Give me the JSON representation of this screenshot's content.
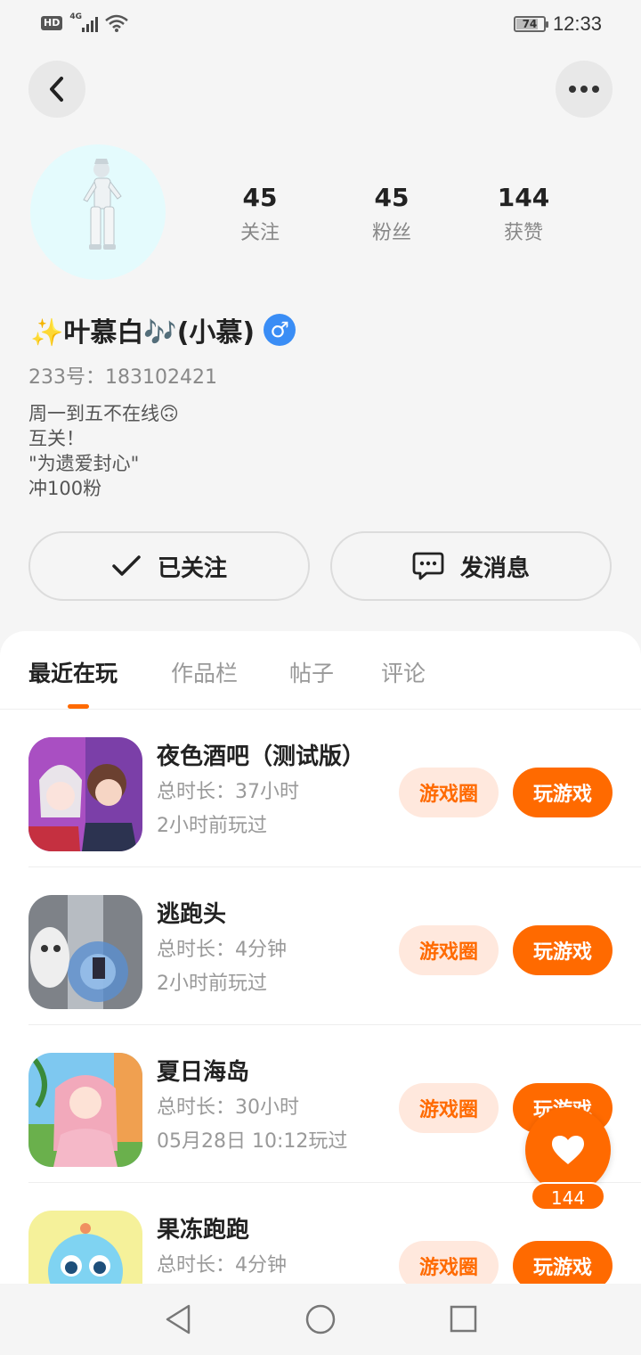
{
  "status_bar": {
    "hd": "HD",
    "network": "4G",
    "battery": "74",
    "battery_level": 0.74,
    "time": "12:33"
  },
  "profile": {
    "stats": [
      {
        "value": "45",
        "label": "关注"
      },
      {
        "value": "45",
        "label": "粉丝"
      },
      {
        "value": "144",
        "label": "获赞"
      }
    ],
    "name": "✨叶慕白🎶(小慕)",
    "gender_symbol": "♂",
    "uid": "233号：183102421",
    "bio": [
      "周一到五不在线🙃",
      "互关！",
      "\"为遗爱封心\"",
      "冲100粉"
    ]
  },
  "actions": {
    "follow_label": "已关注",
    "message_label": "发消息"
  },
  "tabs": [
    "最近在玩",
    "作品栏",
    "帖子",
    "评论"
  ],
  "games": [
    {
      "title": "夜色酒吧（测试版）",
      "duration": "总时长：37小时",
      "last_played": "2小时前玩过"
    },
    {
      "title": "逃跑头",
      "duration": "总时长：4分钟",
      "last_played": "2小时前玩过"
    },
    {
      "title": "夏日海岛",
      "duration": "总时长：30小时",
      "last_played": "05月28日 10:12玩过"
    },
    {
      "title": "果冻跑跑",
      "duration": "总时长：4分钟",
      "last_played": ""
    }
  ],
  "game_buttons": {
    "circle": "游戏圈",
    "play": "玩游戏"
  },
  "like": {
    "count": "144"
  },
  "colors": {
    "accent": "#ff6a00",
    "accent_light": "#ffe8dd",
    "gender_blue": "#3a8df5"
  }
}
